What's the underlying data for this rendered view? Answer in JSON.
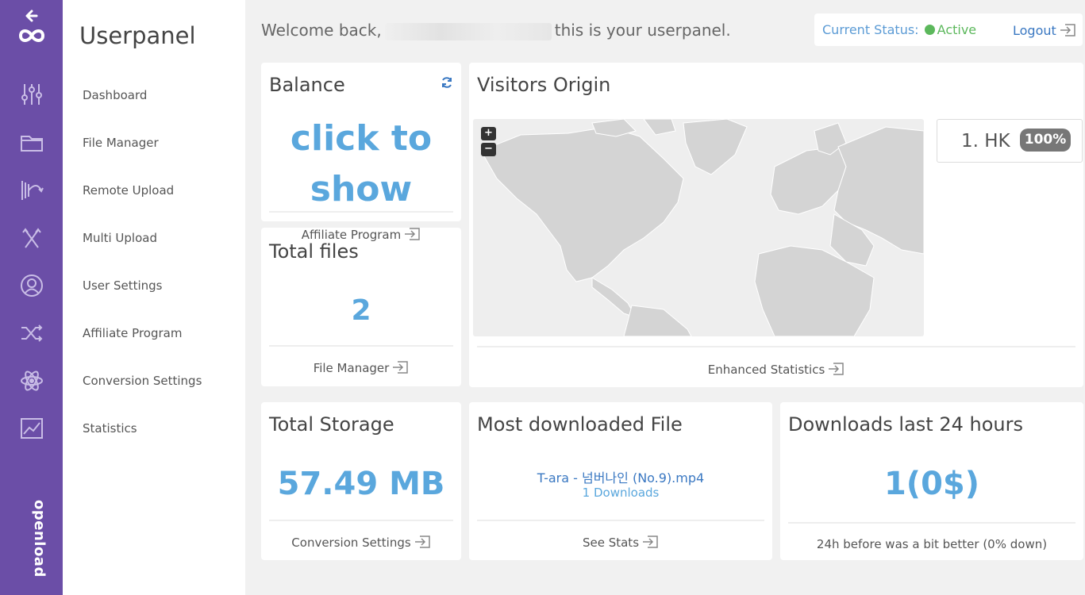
{
  "rail": {
    "brand": "openload",
    "icons": [
      "back-arrow-icon",
      "infinity-logo-icon",
      "sliders-icon",
      "folder-icon",
      "remote-upload-icon",
      "multi-upload-icon",
      "user-icon",
      "shuffle-icon",
      "atom-icon",
      "chart-icon"
    ]
  },
  "sidenav": {
    "title": "Userpanel",
    "items": [
      {
        "label": "Dashboard"
      },
      {
        "label": "File Manager"
      },
      {
        "label": "Remote Upload"
      },
      {
        "label": "Multi Upload"
      },
      {
        "label": "User Settings"
      },
      {
        "label": "Affiliate Program"
      },
      {
        "label": "Conversion Settings"
      },
      {
        "label": "Statistics"
      }
    ]
  },
  "header": {
    "welcome_prefix": "Welcome back,",
    "welcome_suffix": "this is your userpanel.",
    "status_label": "Current Status:",
    "status_value": "Active",
    "logout_label": "Logout"
  },
  "balance": {
    "title": "Balance",
    "value": "click to show",
    "link": "Affiliate Program"
  },
  "total_files": {
    "title": "Total files",
    "value": "2",
    "link": "File Manager"
  },
  "visitors": {
    "title": "Visitors Origin",
    "zoom_in": "+",
    "zoom_out": "−",
    "rank": "1. HK",
    "rank_percent": "100%",
    "link": "Enhanced Statistics"
  },
  "total_storage": {
    "title": "Total Storage",
    "value": "57.49 MB",
    "link": "Conversion Settings"
  },
  "most_downloaded": {
    "title": "Most downloaded File",
    "file_name": "T-ara - 넘버나인 (No.9).mp4",
    "downloads": "1 Downloads",
    "link": "See Stats"
  },
  "downloads_24h": {
    "title": "Downloads last 24 hours",
    "value": "1(0$)",
    "note": "24h before was a bit better (0% down)"
  },
  "colors": {
    "rail": "#6b4ea7",
    "accent_blue": "#5aa7dd",
    "active_green": "#5cb85c"
  }
}
